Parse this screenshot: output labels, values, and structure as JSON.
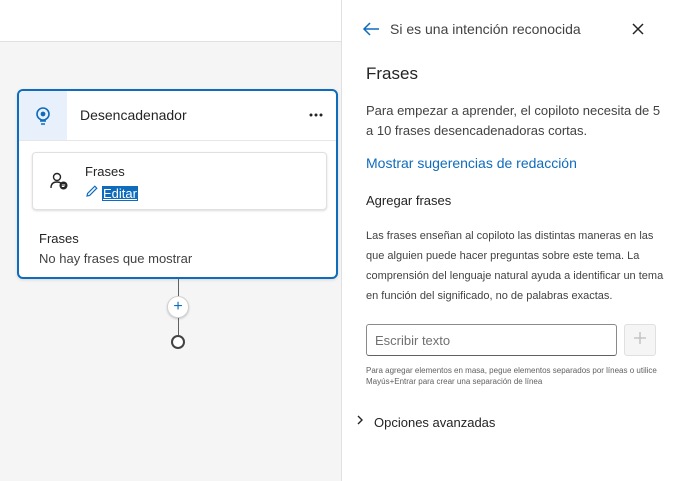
{
  "trigger_node": {
    "title": "Desencadenador",
    "more_label": "···",
    "card": {
      "title": "Frases",
      "edit_label": "Editar"
    },
    "section_title": "Frases",
    "section_value": "No hay frases que mostrar"
  },
  "add_button_label": "+",
  "panel": {
    "breadcrumb": "Si es una intención reconocida",
    "title": "Frases",
    "description": "Para empezar a aprender, el copiloto necesita de 5 a 10 frases desencadenadoras cortas.",
    "suggestions_link": "Mostrar sugerencias de redacción",
    "add_phrases_title": "Agregar frases",
    "help_text": "Las frases enseñan al copiloto las distintas maneras en las que alguien puede hacer preguntas sobre este tema. La comprensión del lenguaje natural ayuda a identificar un tema en función del significado, no de palabras exactas.",
    "input_placeholder": "Escribir texto",
    "input_value": "",
    "bulk_hint": "Para agregar elementos en masa, pegue elementos separados por líneas o utilice Mayús+Entrar para crear una separación de línea",
    "advanced_label": "Opciones avanzadas"
  },
  "icons": {
    "trigger": "trigger-bulb-icon",
    "more": "more-icon",
    "person": "person-chat-icon",
    "edit": "pencil-icon",
    "back": "arrow-left-icon",
    "close": "close-icon",
    "add": "plus-icon",
    "expand": "chevron-right-icon"
  },
  "colors": {
    "accent": "#0f6cbd",
    "node_header_bg": "#e8f1fb"
  }
}
